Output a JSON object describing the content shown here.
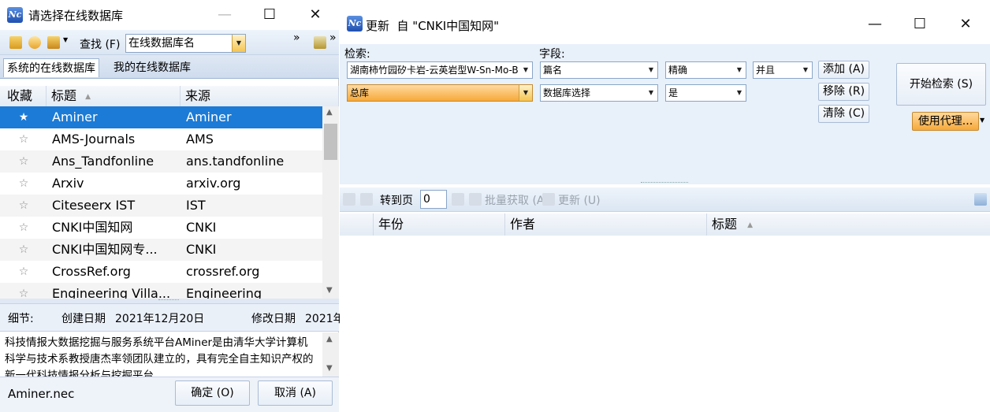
{
  "left_window": {
    "title": "请选择在线数据库",
    "controls": {
      "minimize": "—",
      "maximize": "☐",
      "close": "✕"
    },
    "toolbar": {
      "find_label": "查找 (F)",
      "find_value": "在线数据库名",
      "overflow": "»",
      "overflow2": "»"
    },
    "tabs": [
      "系统的在线数据库",
      "我的在线数据库"
    ],
    "columns": {
      "fav": "收藏",
      "title": "标题",
      "source": "来源",
      "sort_arrow": "▲"
    },
    "rows": [
      {
        "star": "★",
        "title": "Aminer",
        "source": "Aminer"
      },
      {
        "star": "☆",
        "title": "AMS-Journals",
        "source": "AMS"
      },
      {
        "star": "☆",
        "title": "Ans_Tandfonline",
        "source": "ans.tandfonline"
      },
      {
        "star": "☆",
        "title": "Arxiv",
        "source": "arxiv.org"
      },
      {
        "star": "☆",
        "title": "Citeseerx IST",
        "source": "IST"
      },
      {
        "star": "☆",
        "title": "CNKI中国知网",
        "source": "CNKI"
      },
      {
        "star": "☆",
        "title": "CNKI中国知网专...",
        "source": "CNKI"
      },
      {
        "star": "☆",
        "title": "CrossRef.org",
        "source": "crossref.org"
      },
      {
        "star": "☆",
        "title": "Engineering Villa...",
        "source": "Engineering"
      }
    ],
    "details": {
      "label": "细节:",
      "created_label": "创建日期",
      "created_value": "2021年12月20日",
      "modified_label": "修改日期",
      "modified_value": "2021年"
    },
    "description": "科技情报大数据挖掘与服务系统平台AMiner是由清华大学计算机科学与技术系教授唐杰率领团队建立的，具有完全自主知识产权的新一代科技情报分析与挖掘平台",
    "filename": "Aminer.nec",
    "ok_label": "确定 (O)",
    "cancel_label": "取消 (A)"
  },
  "right_window": {
    "title": "更新  自 \"CNKI中国知网\"",
    "controls": {
      "minimize": "—",
      "maximize": "☐",
      "close": "✕"
    },
    "search_label": "检索:",
    "field_label": "字段:",
    "query_value": "湖南柿竹园矽卡岩-云英岩型W-Sn-Mo-B",
    "field_value": "篇名",
    "match_value": "精确",
    "logic_value": "并且",
    "db_value": "总库",
    "db_field_value": "数据库选择",
    "db_match_value": "是",
    "add_label": "添加 (A)",
    "remove_label": "移除 (R)",
    "clear_label": "清除 (C)",
    "start_label": "开始检索 (S)",
    "proxy_label": "使用代理...",
    "goto_label": "转到页",
    "goto_value": "0",
    "batch_label": "批量获取 (A)",
    "update_label": "更新 (U)",
    "columns": {
      "year": "年份",
      "author": "作者",
      "title": "标题",
      "sort_arrow": "▲"
    }
  },
  "colors": {
    "selection": "#1c7bd6",
    "orange": "#f7a93a",
    "header_bg": "#e4ebf4"
  }
}
